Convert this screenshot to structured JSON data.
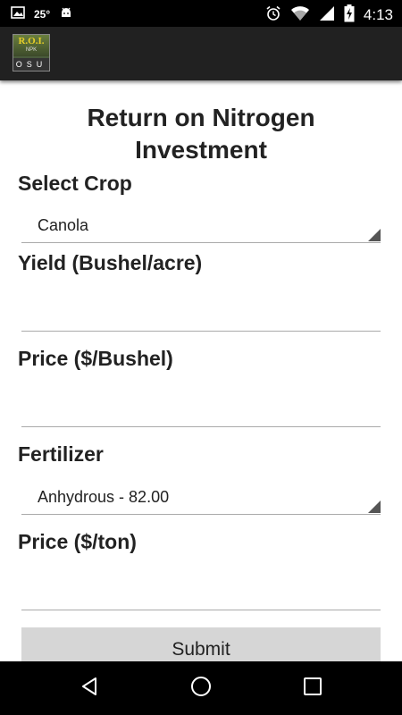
{
  "status_bar": {
    "temperature": "25°",
    "time": "4:13",
    "icons": [
      "image-icon",
      "android-icon",
      "alarm-icon",
      "wifi-icon",
      "signal-icon",
      "battery-charging-icon"
    ]
  },
  "app_bar": {
    "logo": {
      "top": "R.O.I.",
      "middle": "NPK",
      "bottom": "OSU"
    }
  },
  "form": {
    "title": "Return on Nitrogen Investment",
    "select_crop_label": "Select Crop",
    "crop_value": "Canola",
    "yield_label": "Yield (Bushel/acre)",
    "yield_value": "",
    "price_bushel_label": "Price ($/Bushel)",
    "price_bushel_value": "",
    "fertilizer_label": "Fertilizer",
    "fertilizer_value": "Anhydrous - 82.00",
    "price_ton_label": "Price ($/ton)",
    "price_ton_value": "",
    "submit_label": "Submit"
  },
  "nav_bar": {
    "icons": [
      "back-icon",
      "home-icon",
      "recents-icon"
    ]
  },
  "colors": {
    "status_bar": "#000000",
    "app_bar": "#212121",
    "background": "#ffffff",
    "submit_button": "#d6d6d6",
    "nav_bar": "#000000"
  }
}
